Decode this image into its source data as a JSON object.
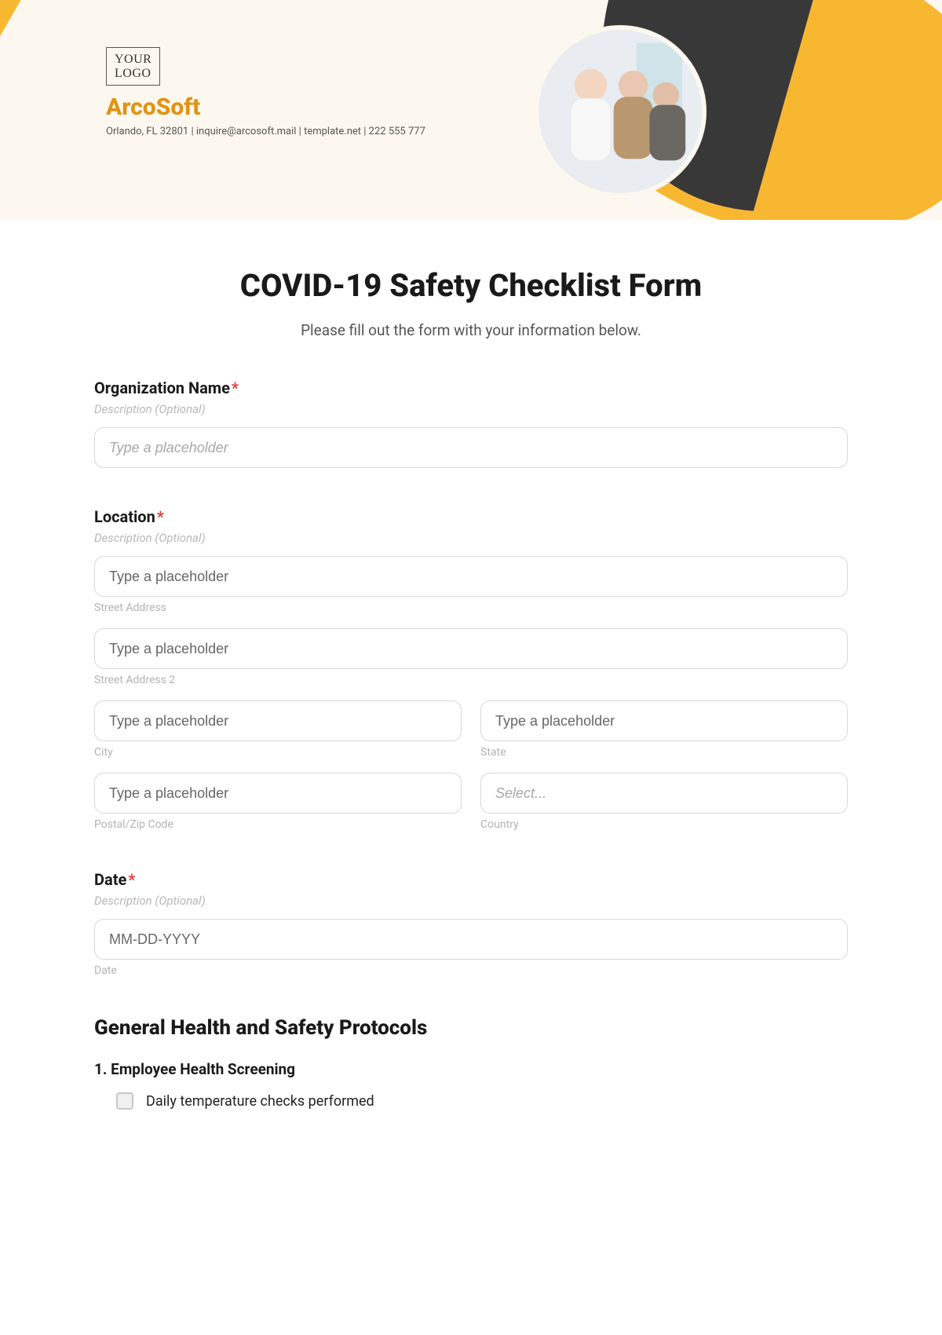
{
  "header": {
    "logo_line1": "YOUR",
    "logo_line2": "LOGO",
    "brand_name": "ArcoSoft",
    "brand_sub": "Orlando, FL 32801 | inquire@arcosoft.mail | template.net | 222 555 777"
  },
  "form": {
    "title": "COVID-19 Safety Checklist Form",
    "subtitle": "Please fill out the form with your information below.",
    "org": {
      "label": "Organization Name",
      "required_mark": "*",
      "desc": "Description (Optional)",
      "placeholder": "Type a placeholder"
    },
    "location": {
      "label": "Location",
      "required_mark": "*",
      "desc": "Description (Optional)",
      "street1_placeholder": "Type a placeholder",
      "street1_sub": "Street Address",
      "street2_placeholder": "Type a placeholder",
      "street2_sub": "Street Address 2",
      "city_placeholder": "Type a placeholder",
      "city_sub": "City",
      "state_placeholder": "Type a placeholder",
      "state_sub": "State",
      "postal_placeholder": "Type a placeholder",
      "postal_sub": "Postal/Zip Code",
      "country_placeholder": "Select...",
      "country_sub": "Country"
    },
    "date": {
      "label": "Date",
      "required_mark": "*",
      "desc": "Description (Optional)",
      "placeholder": "MM-DD-YYYY",
      "sub": "Date"
    },
    "protocols": {
      "heading": "General Health and Safety Protocols",
      "sub1_title": "1. Employee Health Screening",
      "check1": "Daily temperature checks performed"
    }
  }
}
